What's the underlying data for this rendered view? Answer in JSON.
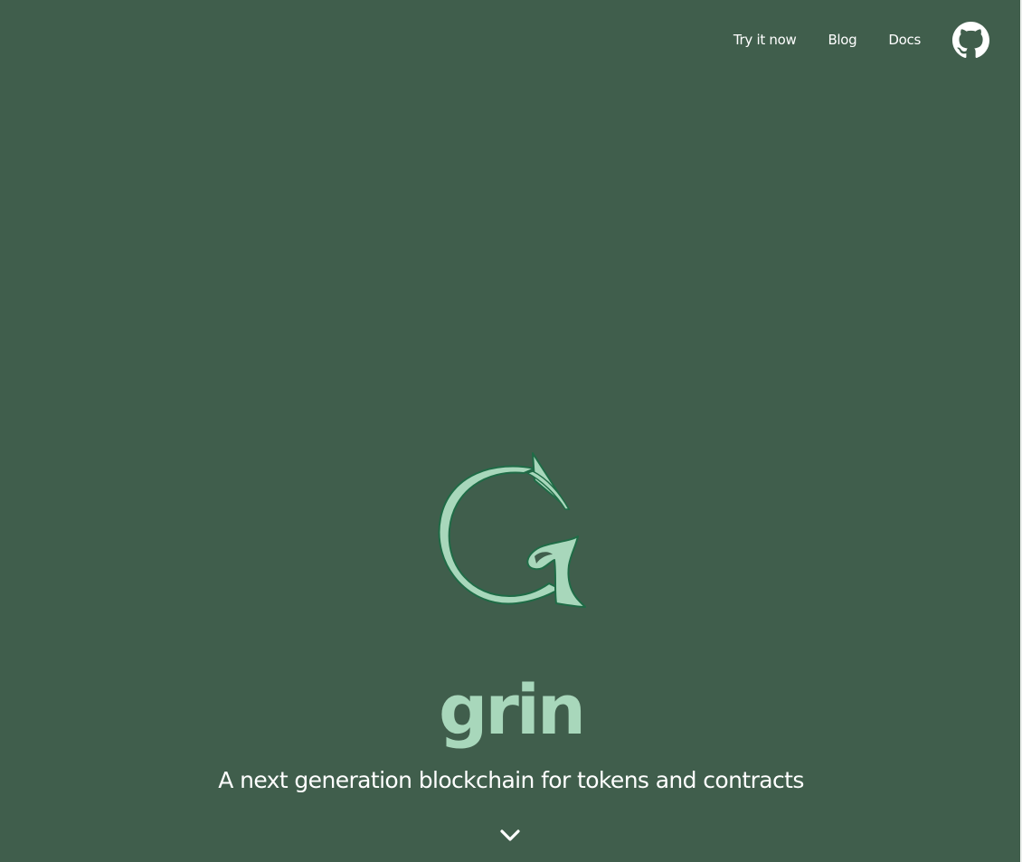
{
  "nav": {
    "items": [
      {
        "label": "Try it now"
      },
      {
        "label": "Blog"
      },
      {
        "label": "Docs"
      }
    ],
    "github_icon": "github-icon"
  },
  "hero": {
    "logo_icon": "grin-logo-icon",
    "brand": "grin",
    "tagline": "A next generation blockchain for tokens and contracts",
    "scroll_icon": "chevron-down-icon"
  },
  "colors": {
    "background": "#405e4c",
    "accent": "#a8d7bb",
    "text": "#ffffff"
  }
}
